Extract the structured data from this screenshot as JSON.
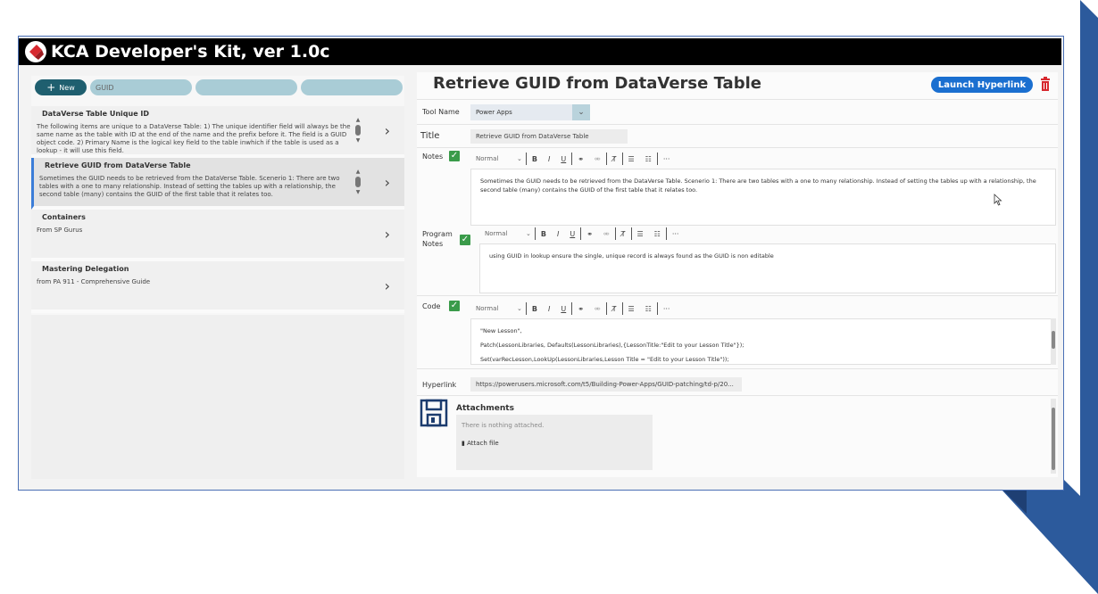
{
  "app": {
    "title": "KCA Developer's Kit, ver 1.0c"
  },
  "left": {
    "new_label": "New",
    "search_value": "GUID",
    "items": [
      {
        "title": "DataVerse Table Unique ID",
        "desc": "The following items are unique to a DataVerse Table: 1) The unique identifier field will always be the same name as the table with ID at the end of the name and the prefix before it. The field is a GUID object code. 2) Primary Name is the logical key field to the table inwhich if the table is used as a lookup - it will use this field."
      },
      {
        "title": "Retrieve GUID from DataVerse Table",
        "desc": "Sometimes the GUID needs to be retrieved from the DataVerse Table. Scenerio 1: There are two tables with a one to many relationship. Instead of setting the tables up with a relationship, the second table (many) contains the GUID of the first table that it relates too."
      },
      {
        "title": "Containers",
        "desc": "From SP Gurus"
      },
      {
        "title": "Mastering Delegation",
        "desc": "from PA 911 - Comprehensive Guide"
      }
    ]
  },
  "detail": {
    "title": "Retrieve GUID from DataVerse Table",
    "launch_label": "Launch Hyperlink",
    "tool_name_label": "Tool Name",
    "tool_name_value": "Power Apps",
    "title_label": "Title",
    "title_value": "Retrieve GUID from DataVerse Table",
    "notes_label": "Notes",
    "notes_text": "Sometimes the GUID needs to be retrieved from the DataVerse Table. Scenerio 1: There are two tables with a one to many relationship. Instead of setting the tables up with a relationship, the second table (many) contains the GUID of the first table that it relates too.",
    "program_notes_label_1": "Program",
    "program_notes_label_2": "Notes",
    "program_notes_text": "using GUID in lookup ensure the single, unique record is always found as the GUID is non editable",
    "code_label": "Code",
    "code_lines": [
      "\"New Lesson\",",
      "Patch(LessonLibraries, Defaults(LessonLibraries),{LessonTitle:\"Edit to your Lesson Title\"});",
      "Set(varRecLesson,LookUp(LessonLibraries,Lesson Title = \"Edit to your Lesson Title\"));"
    ],
    "hyperlink_label": "Hyperlink",
    "hyperlink_value": "https://powerusers.microsoft.com/t5/Building-Power-Apps/GUID-patching/td-p/20...",
    "attachments_label": "Attachments",
    "attachments_empty": "There is nothing attached.",
    "attach_file_label": "Attach file"
  },
  "toolbar": {
    "format": "Normal",
    "more": "···"
  },
  "colors": {
    "accent": "#1a6fd0",
    "titlebar": "#000000",
    "check": "#3a9b4a",
    "new_button": "#1f5f6f"
  }
}
